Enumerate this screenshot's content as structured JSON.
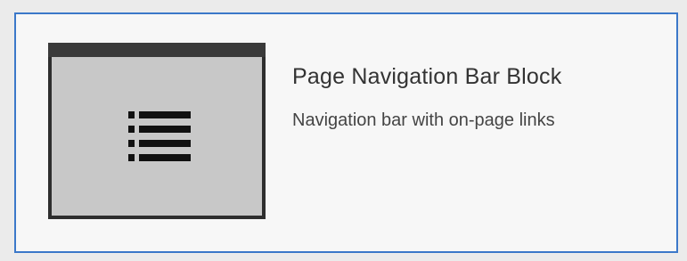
{
  "block": {
    "title": "Page Navigation Bar Block",
    "description": "Navigation bar with on-page links",
    "thumbnail_icon": "list-icon"
  },
  "colors": {
    "selection_border": "#3b78c9",
    "card_background": "#f7f7f7",
    "thumbnail_background": "#c8c8c8",
    "thumbnail_frame": "#2e2e2e"
  }
}
